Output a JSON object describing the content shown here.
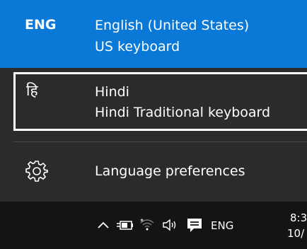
{
  "languages": [
    {
      "code": "ENG",
      "name": "English (United States)",
      "keyboard": "US keyboard",
      "selected": true
    },
    {
      "glyph": "हि",
      "name": "Hindi",
      "keyboard": "Hindi Traditional keyboard",
      "selected": false
    }
  ],
  "preferences": {
    "label": "Language preferences",
    "icon": "gear-icon"
  },
  "taskbar": {
    "input_indicator": "ENG",
    "time": "8:3",
    "date": "10/",
    "icons": [
      "chevron-up-icon",
      "battery-plug-icon",
      "wifi-icon",
      "volume-icon",
      "action-center-icon"
    ]
  },
  "colors": {
    "accent": "#0a78d7",
    "flyout_bg": "#2b2b2b",
    "taskbar_bg": "#141414",
    "text": "#ffffff"
  }
}
